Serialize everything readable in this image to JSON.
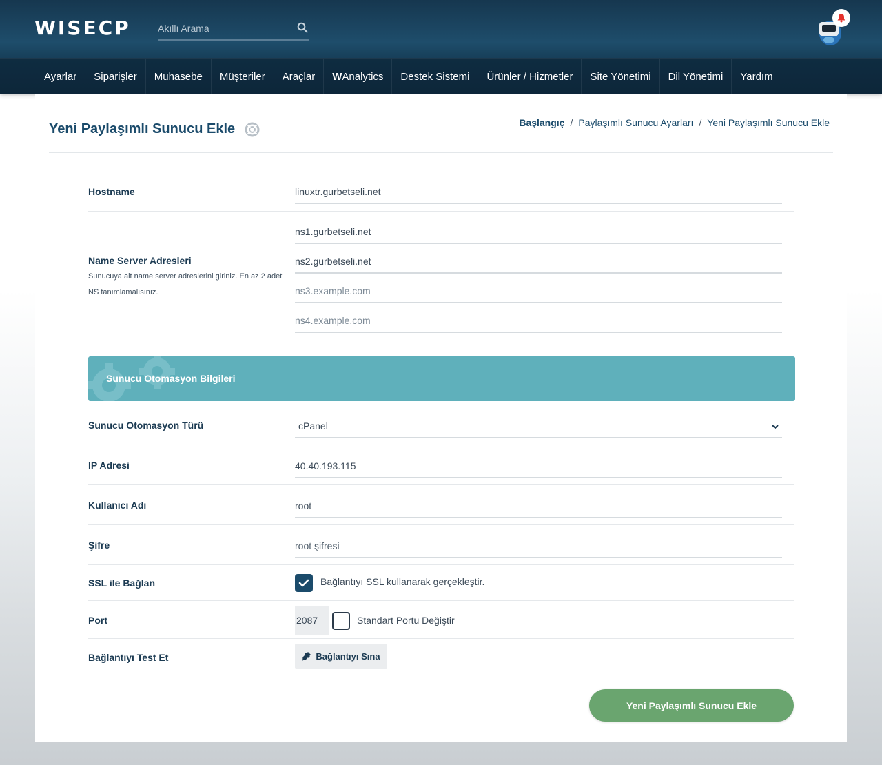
{
  "header": {
    "logo_text": "WISECP",
    "search": {
      "placeholder": "Akıllı Arama"
    },
    "nav": [
      {
        "label": "Ayarlar"
      },
      {
        "label": "Siparişler"
      },
      {
        "label": "Muhasebe"
      },
      {
        "label": "Müşteriler"
      },
      {
        "label": "Araçlar"
      },
      {
        "label_bold": "W",
        "label": "Analytics"
      },
      {
        "label": "Destek Sistemi"
      },
      {
        "label": "Ürünler / Hizmetler"
      },
      {
        "label": "Site Yönetimi"
      },
      {
        "label": "Dil Yönetimi"
      },
      {
        "label": "Yardım"
      }
    ]
  },
  "page": {
    "title": "Yeni Paylaşımlı Sunucu Ekle",
    "breadcrumb": [
      "Başlangıç",
      "Paylaşımlı Sunucu Ayarları",
      "Yeni Paylaşımlı Sunucu Ekle"
    ]
  },
  "form": {
    "hostname": {
      "label": "Hostname",
      "value": "linuxtr.gurbetseli.net"
    },
    "nameservers": {
      "label": "Name Server Adresleri",
      "description": "Sunucuya ait name server adreslerini giriniz. En az 2 adet NS tanımlamalısınız.",
      "ns1": "ns1.gurbetseli.net",
      "ns2": "ns2.gurbetseli.net",
      "ns3_placeholder": "ns3.example.com",
      "ns4_placeholder": "ns4.example.com"
    },
    "section_title": "Sunucu Otomasyon Bilgileri",
    "automation_type": {
      "label": "Sunucu Otomasyon Türü",
      "value": "cPanel"
    },
    "ip": {
      "label": "IP Adresi",
      "value": "40.40.193.115"
    },
    "username": {
      "label": "Kullanıcı Adı",
      "value": "root"
    },
    "password": {
      "label": "Şifre",
      "placeholder": "root şifresi"
    },
    "ssl": {
      "label": "SSL ile Bağlan",
      "checked": true,
      "checkbox_label": "Bağlantıyı SSL kullanarak gerçekleştir."
    },
    "port": {
      "label": "Port",
      "value": "2087",
      "checked": false,
      "checkbox_label": "Standart Portu Değiştir"
    },
    "test": {
      "label": "Bağlantıyı Test Et",
      "button_label": "Bağlantıyı Sına"
    },
    "submit_label": "Yeni Paylaşımlı Sunucu Ekle"
  },
  "colors": {
    "header_bg": "#1e4d6b",
    "title": "#1b4b6b",
    "section_bar": "#5fb0bb",
    "submit": "#6aa56f",
    "notification": "#e5322d"
  }
}
